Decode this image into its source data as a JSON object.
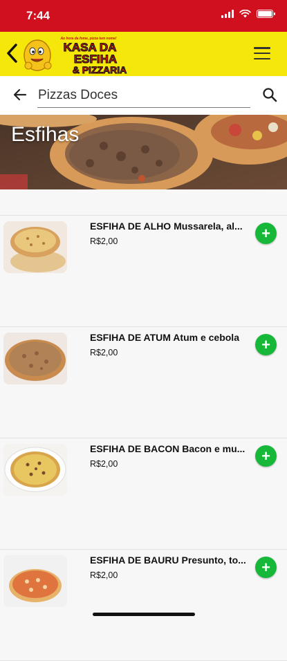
{
  "status": {
    "time": "7:44"
  },
  "header": {
    "logo": {
      "tagline": "Ao hora da fome, pizza tem nome!",
      "line1": "KASA DA",
      "line2": "ESFIHA",
      "line3": "& PIZZARIA"
    },
    "back_icon": "chevron-left-icon",
    "menu_icon": "hamburger-menu-icon"
  },
  "search": {
    "value": "Pizzas Doces",
    "back_icon": "arrow-left-icon",
    "search_icon": "magnifier-icon"
  },
  "banner": {
    "title": "Esfihas"
  },
  "items": [
    {
      "title": "ESFIHA DE ALHO Mussarela, al...",
      "price": "R$2,00",
      "add_label": "+"
    },
    {
      "title": "ESFIHA DE ATUM Atum e cebola",
      "price": "R$2,00",
      "add_label": "+"
    },
    {
      "title": "ESFIHA DE BACON Bacon e mu...",
      "price": "R$2,00",
      "add_label": "+"
    },
    {
      "title": "ESFIHA DE BAURU Presunto, to...",
      "price": "R$2,00",
      "add_label": "+"
    }
  ],
  "colors": {
    "status_bar": "#d0101e",
    "header": "#f6e70a",
    "add_button": "#17b83a"
  }
}
